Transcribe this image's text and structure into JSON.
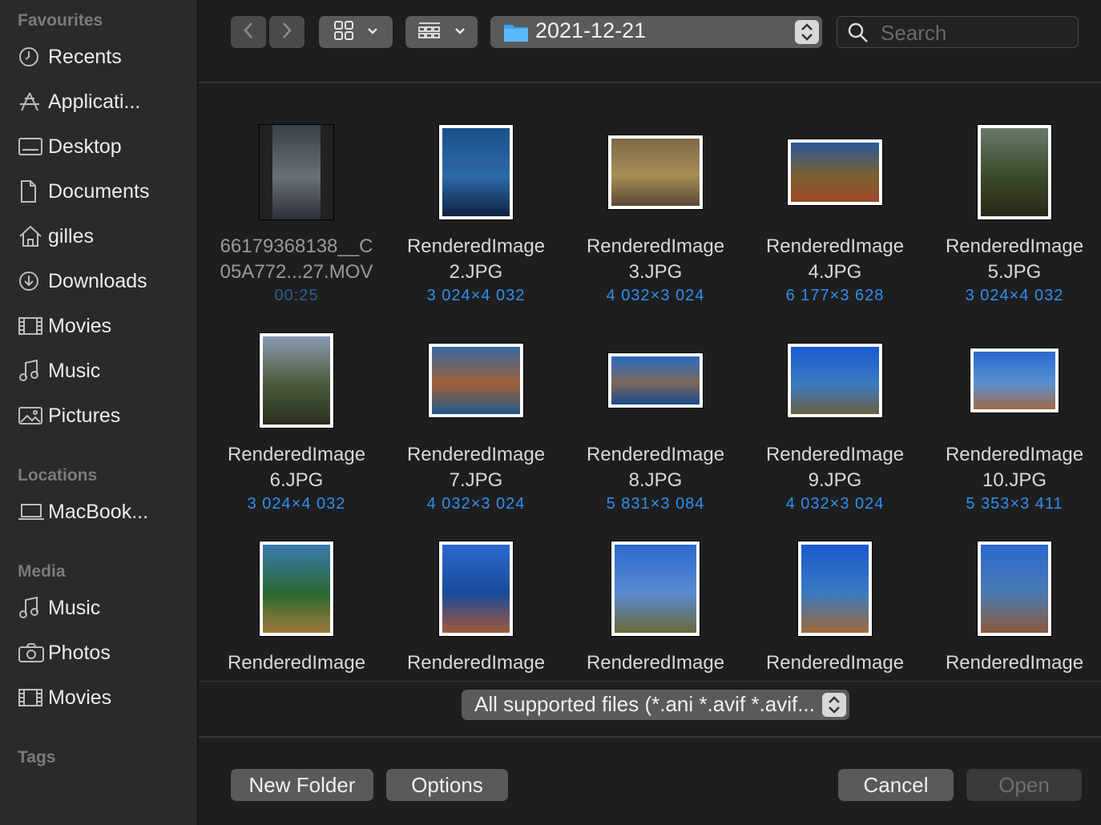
{
  "sidebar": {
    "sections": [
      {
        "title": "Favourites"
      },
      {
        "title": "Locations"
      },
      {
        "title": "Media"
      },
      {
        "title": "Tags"
      }
    ],
    "favourites": [
      {
        "label": "Recents",
        "icon": "clock-icon"
      },
      {
        "label": "Applicati...",
        "icon": "applications-icon"
      },
      {
        "label": "Desktop",
        "icon": "desktop-icon"
      },
      {
        "label": "Documents",
        "icon": "document-icon"
      },
      {
        "label": "gilles",
        "icon": "home-icon"
      },
      {
        "label": "Downloads",
        "icon": "download-icon"
      },
      {
        "label": "Movies",
        "icon": "film-icon"
      },
      {
        "label": "Music",
        "icon": "music-note-icon"
      },
      {
        "label": "Pictures",
        "icon": "photo-icon"
      }
    ],
    "locations": [
      {
        "label": "MacBook...",
        "icon": "laptop-icon"
      }
    ],
    "media": [
      {
        "label": "Music",
        "icon": "music-note-icon"
      },
      {
        "label": "Photos",
        "icon": "camera-icon"
      },
      {
        "label": "Movies",
        "icon": "film-icon"
      }
    ]
  },
  "toolbar": {
    "path": "2021-12-21",
    "search_placeholder": "Search"
  },
  "files": [
    {
      "name1": "66179368138__C",
      "name2": "05A772...27.MOV",
      "meta": "00:25",
      "colors": [
        "#3a4048",
        "#6a7078",
        "#2c3038"
      ]
    },
    {
      "name1": "RenderedImage",
      "name2": "2.JPG",
      "meta": "3 024×4 032",
      "colors": [
        "#1b4f8a",
        "#2d6aa8",
        "#0d2240"
      ]
    },
    {
      "name1": "RenderedImage",
      "name2": "3.JPG",
      "meta": "4 032×3 024",
      "colors": [
        "#7d6a4a",
        "#a88d55",
        "#5a4a34"
      ]
    },
    {
      "name1": "RenderedImage",
      "name2": "4.JPG",
      "meta": "6 177×3 628",
      "colors": [
        "#2a5a9a",
        "#7a6030",
        "#a04a2a"
      ]
    },
    {
      "name1": "RenderedImage",
      "name2": "5.JPG",
      "meta": "3 024×4 032",
      "colors": [
        "#6a7a6a",
        "#3a4a2a",
        "#2a2818"
      ]
    },
    {
      "name1": "RenderedImage",
      "name2": "6.JPG",
      "meta": "3 024×4 032",
      "colors": [
        "#8a9ab0",
        "#4a5a3a",
        "#2a3020"
      ]
    },
    {
      "name1": "RenderedImage",
      "name2": "7.JPG",
      "meta": "4 032×3 024",
      "colors": [
        "#3a6aa0",
        "#a0603a",
        "#205a8a"
      ]
    },
    {
      "name1": "RenderedImage",
      "name2": "8.JPG",
      "meta": "5 831×3 084",
      "colors": [
        "#2a6ac0",
        "#7a6a5a",
        "#1a4a8a"
      ]
    },
    {
      "name1": "RenderedImage",
      "name2": "9.JPG",
      "meta": "4 032×3 024",
      "colors": [
        "#1a5ad0",
        "#3a7ac0",
        "#6a6040"
      ]
    },
    {
      "name1": "RenderedImage",
      "name2": "10.JPG",
      "meta": "5 353×3 411",
      "colors": [
        "#2a6ad0",
        "#5a90d0",
        "#a06a4a"
      ]
    },
    {
      "name1": "RenderedImage",
      "name2": "",
      "meta": "",
      "colors": [
        "#3a7ab0",
        "#2a6a30",
        "#a07a3a"
      ]
    },
    {
      "name1": "RenderedImage",
      "name2": "",
      "meta": "",
      "colors": [
        "#2a6ad0",
        "#1a4a9a",
        "#a05a3a"
      ]
    },
    {
      "name1": "RenderedImage",
      "name2": "",
      "meta": "",
      "colors": [
        "#2a6ad0",
        "#5a8ad0",
        "#6a6a3a"
      ]
    },
    {
      "name1": "RenderedImage",
      "name2": "",
      "meta": "",
      "colors": [
        "#1a5ad0",
        "#3a7ac0",
        "#a06a3a"
      ]
    },
    {
      "name1": "RenderedImage",
      "name2": "",
      "meta": "",
      "colors": [
        "#2a6ad0",
        "#4a7ab0",
        "#8a5a3a"
      ]
    }
  ],
  "filter": {
    "label": "All supported files (*.ani *.avif *.avif..."
  },
  "buttons": {
    "new_folder": "New Folder",
    "options": "Options",
    "cancel": "Cancel",
    "open": "Open"
  },
  "colors": {
    "accent": "#2f8ff0",
    "button": "#5a5a5a",
    "sidebar": "#2b2929",
    "background": "#1e1e1e"
  }
}
